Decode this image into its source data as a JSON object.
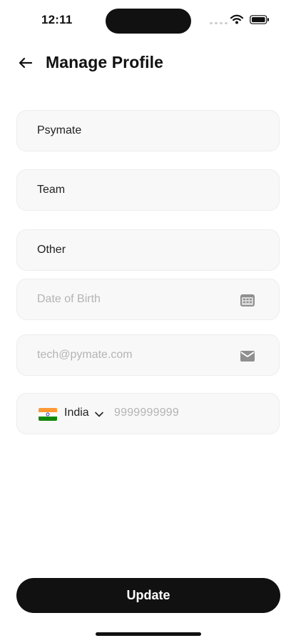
{
  "status_bar": {
    "time": "12:11"
  },
  "header": {
    "title": "Manage Profile",
    "back_icon": "arrow-left-icon"
  },
  "form": {
    "first_name": {
      "value": "Psymate"
    },
    "last_name": {
      "value": "Team"
    },
    "gender": {
      "value": "Other"
    },
    "date_of_birth": {
      "placeholder": "Date of Birth",
      "icon": "calendar-icon"
    },
    "email": {
      "placeholder": "tech@pymate.com",
      "icon": "mail-icon"
    },
    "phone": {
      "country": "India",
      "country_flag": "india-flag-icon",
      "placeholder": "9999999999"
    }
  },
  "footer": {
    "update_label": "Update"
  },
  "colors": {
    "button_background": "#111111",
    "field_background": "#f8f8f8",
    "placeholder": "#b4b4b4"
  }
}
